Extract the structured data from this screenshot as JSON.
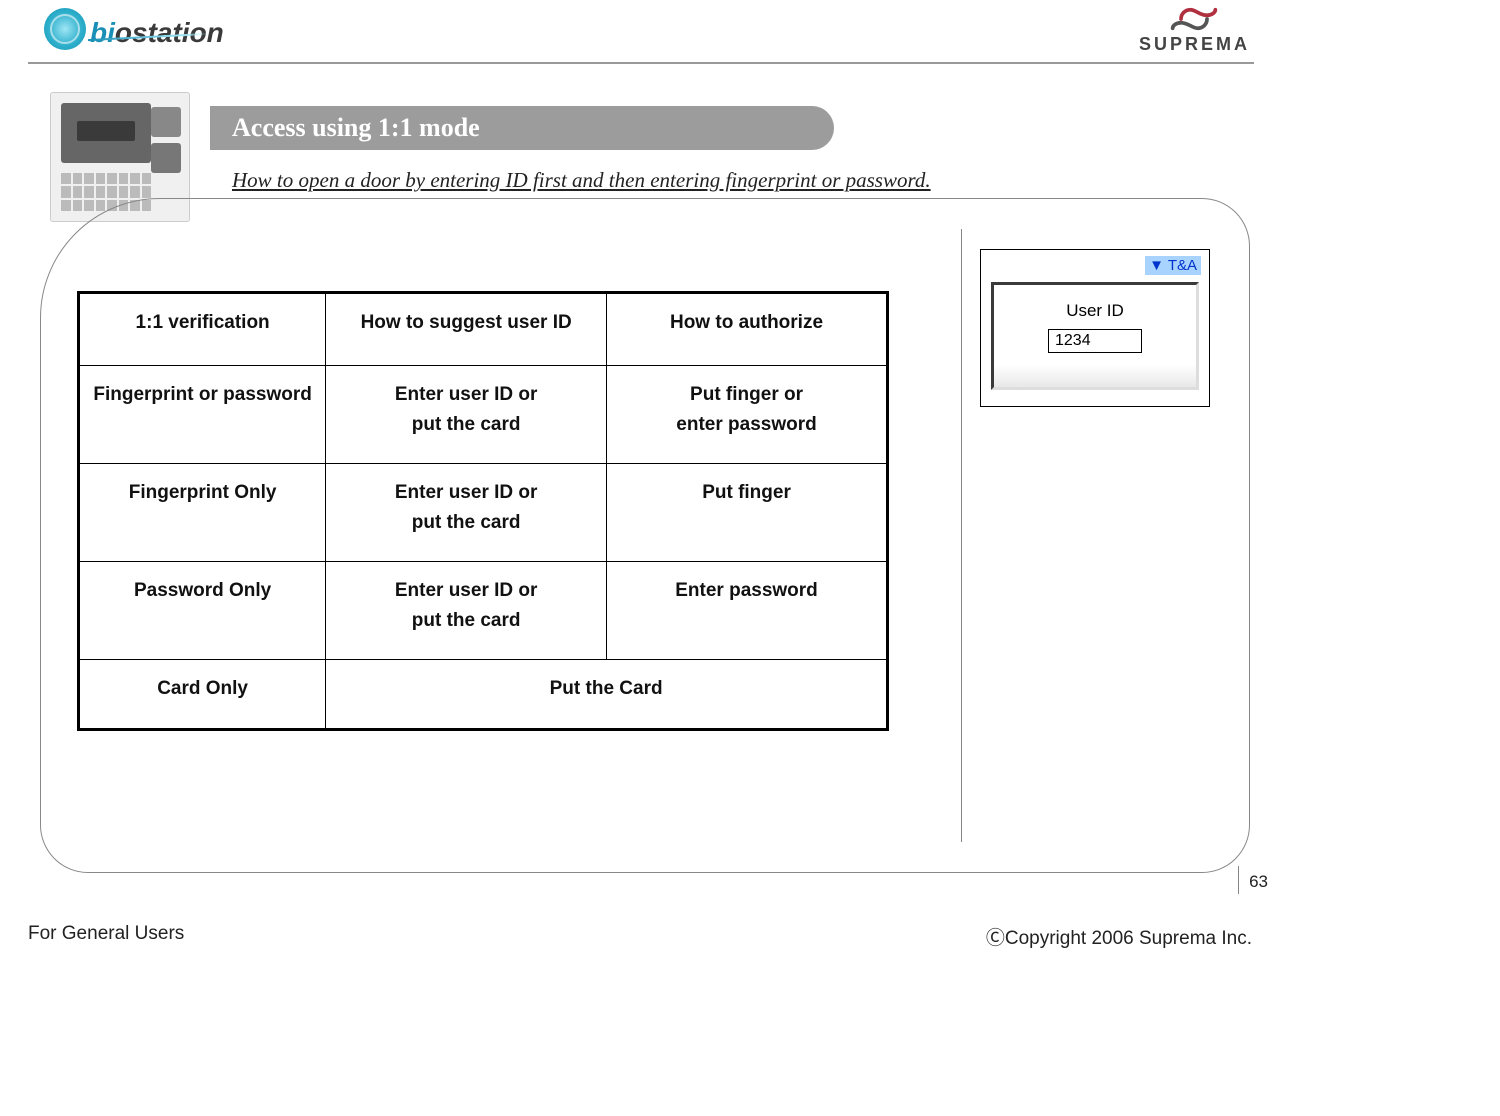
{
  "brand_left": {
    "text_prefix": "bi",
    "text_rest": "ostation"
  },
  "brand_right": "SUPREMA",
  "title": "Access using 1:1 mode",
  "subtitle": "How to open a door by entering ID first and then entering fingerprint or password.",
  "table": {
    "headers": [
      "1:1 verification",
      "How to suggest user ID",
      "How to authorize"
    ],
    "rows": [
      {
        "c1": "Fingerprint or password",
        "c2": "Enter user ID or\nput the card",
        "c3": "Put finger or\nenter password"
      },
      {
        "c1": "Fingerprint Only",
        "c2": "Enter user ID or\nput the card",
        "c3": "Put finger"
      },
      {
        "c1": "Password Only",
        "c2": "Enter user ID or\nput the card",
        "c3": "Enter password"
      },
      {
        "c1": "Card Only",
        "span23": "Put the Card"
      }
    ]
  },
  "panel": {
    "ta_label": "▼ T&A",
    "user_id_label": "User ID",
    "user_id_value": "1234"
  },
  "footer": {
    "left": "For General Users",
    "right": "ⒸCopyright 2006 Suprema Inc.",
    "page": "63"
  }
}
